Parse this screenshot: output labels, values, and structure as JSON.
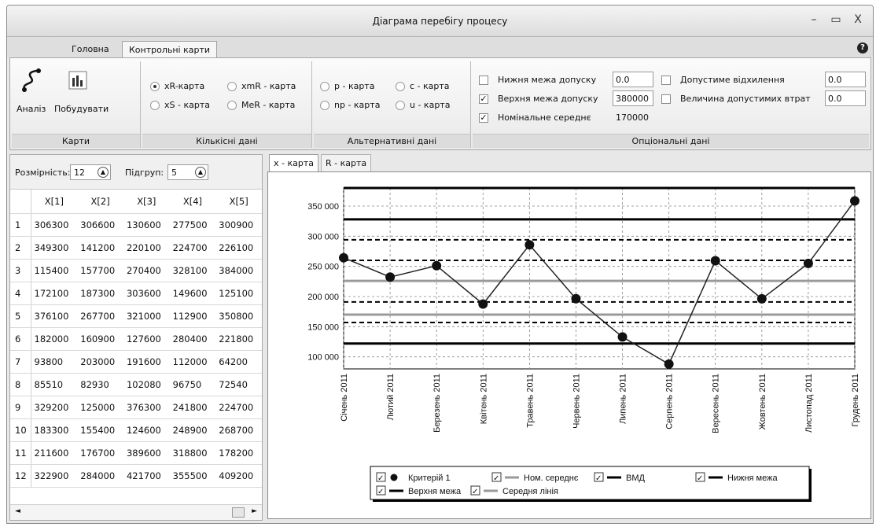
{
  "window": {
    "title": "Діаграма перебігу процесу",
    "minimize": "–",
    "maximize": "▭",
    "close": "X"
  },
  "ribbon_tabs": [
    {
      "label": "Головна"
    },
    {
      "label": "Контрольні карти"
    }
  ],
  "help": "?",
  "groups": {
    "maps": {
      "label": "Карти",
      "analysis": "Аналіз",
      "build": "Побудувати"
    },
    "quant": {
      "label": "Кількісні дані",
      "options": [
        "xR-карта",
        "xmR - карта",
        "xS - карта",
        "MeR - карта"
      ],
      "selected": "xR-карта"
    },
    "alt": {
      "label": "Альтернативні дані",
      "options": [
        "p - карта",
        "c - карта",
        "np - карта",
        "u - карта"
      ]
    },
    "opt": {
      "label": "Опціональні дані",
      "lower": {
        "label": "Нижня межа допуску",
        "value": "0.0",
        "checked": false
      },
      "upper": {
        "label": "Верхня межа допуску",
        "value": "380000",
        "checked": true
      },
      "nominal": {
        "label": "Номінальне середнє",
        "value": "170000",
        "checked": true
      },
      "deviation": {
        "label": "Допустиме відхилення",
        "value": "0.0",
        "checked": false
      },
      "loss": {
        "label": "Величина допустимих втрат",
        "value": "0.0",
        "checked": false
      }
    }
  },
  "params": {
    "dim_label": "Розмірність:",
    "dim_value": "12",
    "sub_label": "Підгруп:",
    "sub_value": "5"
  },
  "table": {
    "columns": [
      "X[1]",
      "X[2]",
      "X[3]",
      "X[4]",
      "X[5]"
    ],
    "rows": [
      [
        "1",
        "306300",
        "306600",
        "130600",
        "277500",
        "300900"
      ],
      [
        "2",
        "349300",
        "141200",
        "220100",
        "224700",
        "226100"
      ],
      [
        "3",
        "115400",
        "157700",
        "270400",
        "328100",
        "384000"
      ],
      [
        "4",
        "172100",
        "187300",
        "303600",
        "149600",
        "125100"
      ],
      [
        "5",
        "376100",
        "267700",
        "321000",
        "112900",
        "350800"
      ],
      [
        "6",
        "182000",
        "160900",
        "127600",
        "280400",
        "221800"
      ],
      [
        "7",
        "93800",
        "203000",
        "191600",
        "112000",
        "64200"
      ],
      [
        "8",
        "85510",
        "82930",
        "102080",
        "96750",
        "72540"
      ],
      [
        "9",
        "329200",
        "125000",
        "376300",
        "241800",
        "224700"
      ],
      [
        "10",
        "183300",
        "155400",
        "124600",
        "248900",
        "268700"
      ],
      [
        "11",
        "211600",
        "176700",
        "389600",
        "318800",
        "178200"
      ],
      [
        "12",
        "322900",
        "284000",
        "421700",
        "355500",
        "409200"
      ]
    ]
  },
  "chart_tabs": [
    "x - карта",
    "R - карта"
  ],
  "chart_data": {
    "type": "line",
    "categories": [
      "Січень 2011",
      "Лютий 2011",
      "Березень 2011",
      "Квітень 2011",
      "Травень 2011",
      "Червень 2011",
      "Липень 2011",
      "Серпень 2011",
      "Вересень 2011",
      "Жовтень 2011",
      "Листопад 2011",
      "Грудень 2011"
    ],
    "ylim": [
      80000,
      380000
    ],
    "yticks": [
      100000,
      150000,
      200000,
      250000,
      300000,
      350000
    ],
    "ytick_labels": [
      "100 000",
      "150 000",
      "200 000",
      "250 000",
      "300 000",
      "350 000"
    ],
    "series": [
      {
        "name": "Критерій 1",
        "values": [
          264320,
          232280,
          251120,
          187540,
          285700,
          196340,
          132920,
          87960,
          259400,
          196180,
          254920,
          358660
        ]
      }
    ],
    "lines": [
      {
        "name": "Верхня межа",
        "value": 380000,
        "style": "solid-black"
      },
      {
        "name": "ВМД",
        "value": 328000,
        "style": "solid-black"
      },
      {
        "name": "",
        "value": 294000,
        "style": "dashed"
      },
      {
        "name": "",
        "value": 260000,
        "style": "dashed"
      },
      {
        "name": "Середня лінія",
        "value": 226000,
        "style": "solid-gray"
      },
      {
        "name": "",
        "value": 191000,
        "style": "dashed"
      },
      {
        "name": "Ном. середнє",
        "value": 170000,
        "style": "solid-gray"
      },
      {
        "name": "",
        "value": 157000,
        "style": "dashed"
      },
      {
        "name": "Нижня межа",
        "value": 122000,
        "style": "solid-black"
      }
    ],
    "grid": true,
    "legend_position": "bottom",
    "legend": [
      {
        "label": "Критерій 1",
        "kind": "marker"
      },
      {
        "label": "Ном. середнє",
        "kind": "gray"
      },
      {
        "label": "ВМД",
        "kind": "black"
      },
      {
        "label": "Нижня межа",
        "kind": "black"
      },
      {
        "label": "Верхня межа",
        "kind": "black"
      },
      {
        "label": "Середня лінія",
        "kind": "gray"
      }
    ],
    "colors": {
      "series": "#222222",
      "limit": "#000000",
      "mean": "#9a9a9a"
    }
  }
}
